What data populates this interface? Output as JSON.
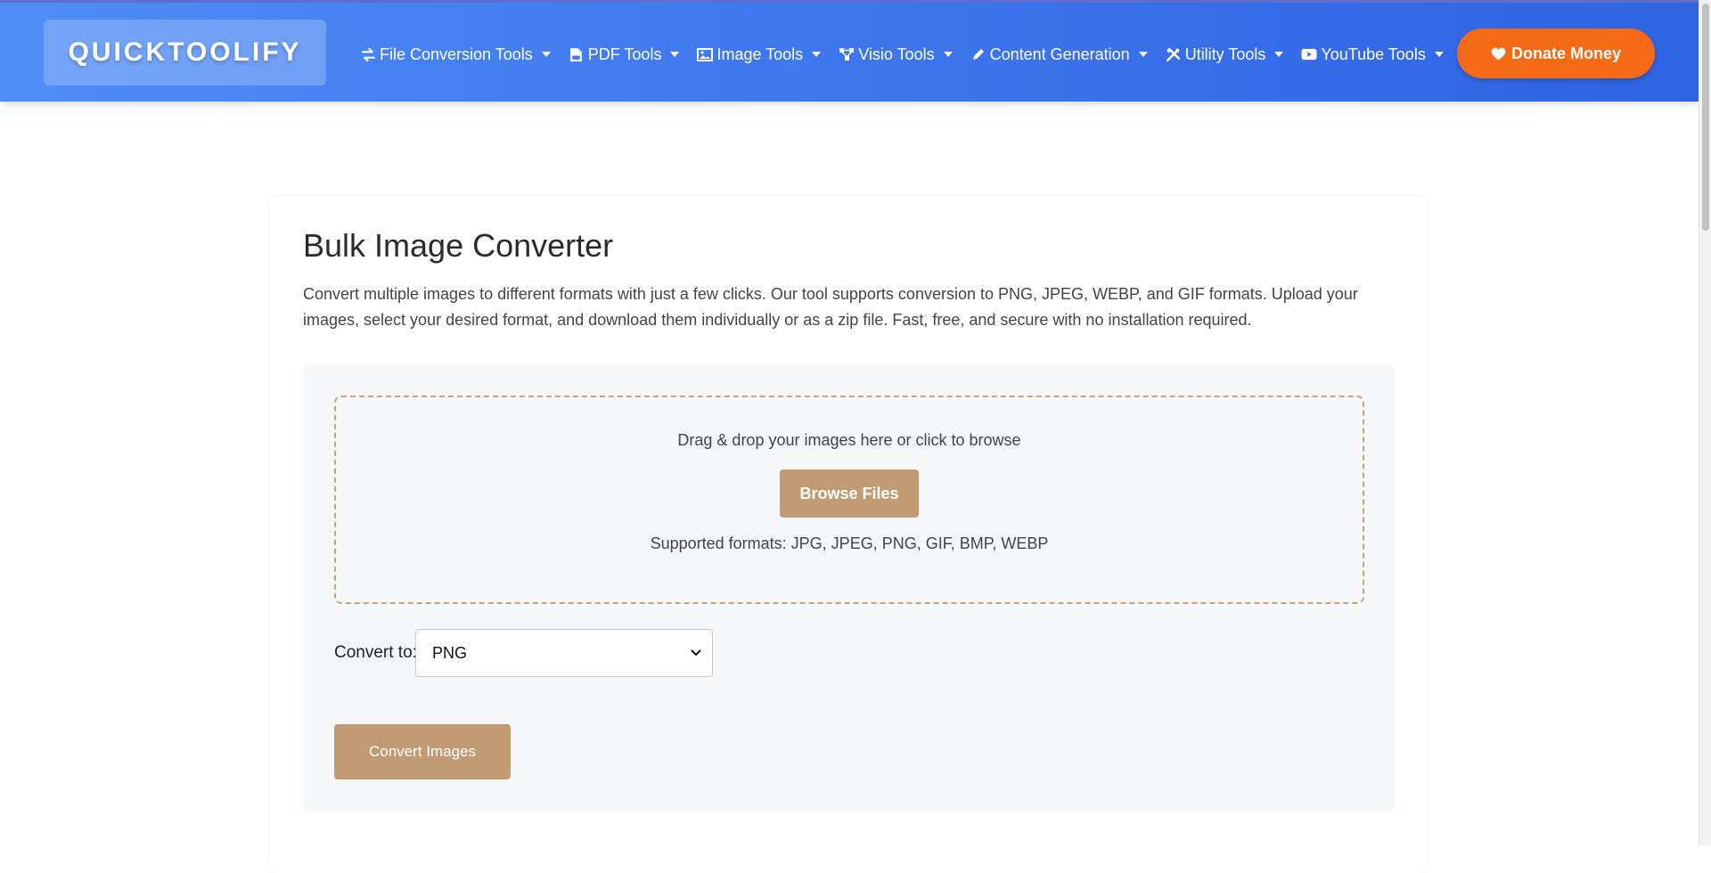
{
  "header": {
    "logo_text": "QUICKTOOLIFY",
    "nav_items": [
      {
        "label": "File Conversion Tools",
        "icon": "exchange-arrows-icon"
      },
      {
        "label": "PDF Tools",
        "icon": "pdf-file-icon"
      },
      {
        "label": "Image Tools",
        "icon": "image-icon"
      },
      {
        "label": "Visio Tools",
        "icon": "diagram-nodes-icon"
      },
      {
        "label": "Content Generation",
        "icon": "pencil-icon"
      },
      {
        "label": "Utility Tools",
        "icon": "tools-icon"
      },
      {
        "label": "YouTube Tools",
        "icon": "youtube-icon"
      }
    ],
    "donate_label": "Donate Money",
    "donate_icon": "heart-icon"
  },
  "main": {
    "title": "Bulk Image Converter",
    "description": "Convert multiple images to different formats with just a few clicks. Our tool supports conversion to PNG, JPEG, WEBP, and GIF formats. Upload your images, select your desired format, and download them individually or as a zip file. Fast, free, and secure with no installation required.",
    "dropzone": {
      "text": "Drag & drop your images here or click to browse",
      "browse_label": "Browse Files",
      "supported_formats": "Supported formats: JPG, JPEG, PNG, GIF, BMP, WEBP"
    },
    "convert_to_label": "Convert to:",
    "format_select": {
      "selected": "PNG"
    },
    "convert_button_label": "Convert Images"
  },
  "colors": {
    "header_gradient_start": "#4f8df6",
    "header_gradient_end": "#2f63e2",
    "donate_orange": "#f56a17",
    "accent_tan": "#c19b73",
    "dropzone_border": "#c8a37d"
  }
}
